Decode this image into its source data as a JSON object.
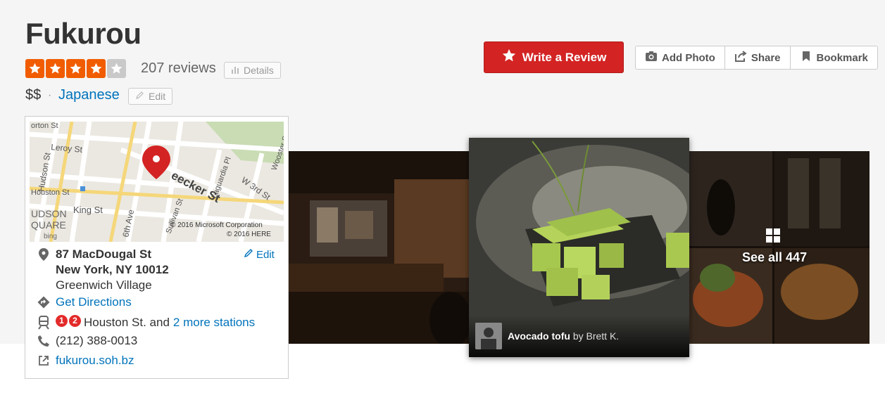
{
  "business": {
    "name": "Fukurou",
    "rating": 4,
    "rating_max": 5,
    "review_count": "207 reviews",
    "details_label": "Details",
    "price": "$$",
    "category": "Japanese",
    "edit_label": "Edit"
  },
  "actions": {
    "write_review": "Write a Review",
    "add_photo": "Add Photo",
    "share": "Share",
    "bookmark": "Bookmark"
  },
  "map": {
    "streets": [
      "orton St",
      "Leroy St",
      "Hudson St",
      "Houston St",
      "King St",
      "6th Ave",
      "Sullivan St",
      "Laguardia Pl",
      "W 3rd St",
      "eecker St",
      "Wooster St"
    ],
    "area_labels": [
      "UDSON",
      "QUARE"
    ],
    "attribution_bing": "bing",
    "attribution_ms": "© 2016 Microsoft Corporation",
    "attribution_here": "© 2016 HERE"
  },
  "location": {
    "address_line1": "87 MacDougal St",
    "address_line2": "New York, NY 10012",
    "neighborhood": "Greenwich Village",
    "edit_label": "Edit",
    "directions": "Get Directions",
    "transit_lines": [
      "1",
      "2"
    ],
    "transit_station": "Houston St. and",
    "transit_more": "2 more stations",
    "phone": "(212) 388-0013",
    "website": "fukurou.soh.bz"
  },
  "photos": {
    "featured_title": "Avocado tofu",
    "featured_by": "by Brett K.",
    "see_all": "See all 447"
  },
  "colors": {
    "brand_red": "#d32323",
    "star_orange": "#f15c00",
    "star_empty": "#c9c9c9",
    "link_blue": "#0073bb"
  },
  "icons": [
    "star-icon",
    "camera-icon",
    "share-icon",
    "bookmark-icon",
    "bar-chart-icon",
    "pencil-icon",
    "map-pin-icon",
    "directions-icon",
    "train-icon",
    "phone-icon",
    "external-link-icon",
    "grid-icon"
  ]
}
